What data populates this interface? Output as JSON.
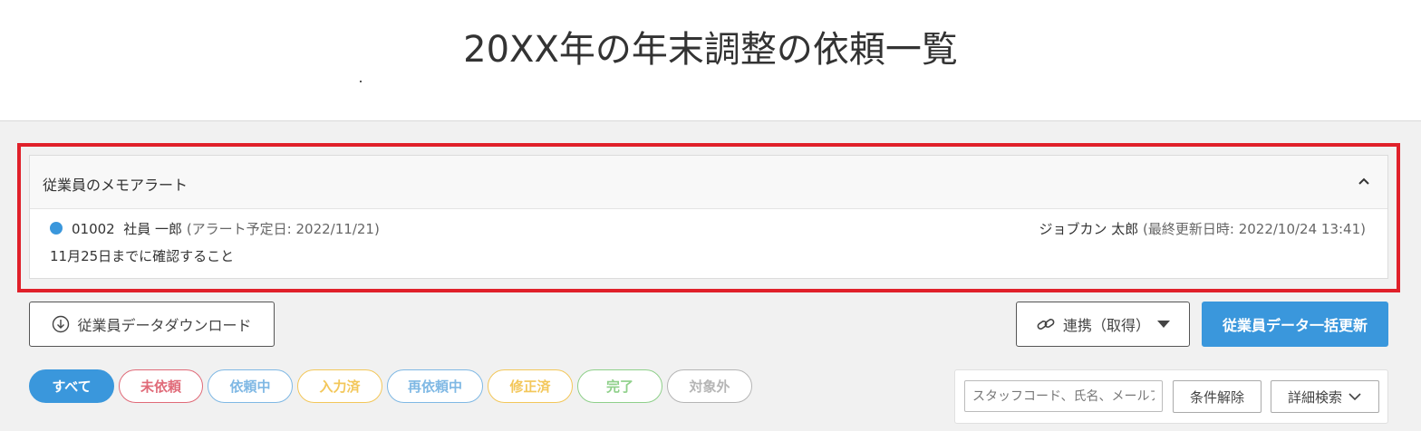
{
  "page": {
    "title": "20XX年の年末調整の依頼一覧"
  },
  "alert": {
    "section_title": "従業員のメモアラート",
    "entry": {
      "staff_code": "01002",
      "employee_name": "社員 一郎",
      "alert_date": "(アラート予定日: 2022/11/21)",
      "updated_by": "ジョブカン 太郎",
      "updated_at": "(最終更新日時: 2022/10/24 13:41)",
      "memo": "11月25日までに確認すること"
    }
  },
  "toolbar": {
    "download_label": "従業員データダウンロード",
    "sync_label": "連携（取得）",
    "bulk_update_label": "従業員データ一括更新"
  },
  "filters": [
    {
      "label": "すべて",
      "color": "#3a97dc",
      "active": true
    },
    {
      "label": "未依頼",
      "color": "#e06a78",
      "active": false
    },
    {
      "label": "依頼中",
      "color": "#7fb8e4",
      "active": false
    },
    {
      "label": "入力済",
      "color": "#f3c75a",
      "active": false
    },
    {
      "label": "再依頼中",
      "color": "#7fb8e4",
      "active": false
    },
    {
      "label": "修正済",
      "color": "#f3c75a",
      "active": false
    },
    {
      "label": "完了",
      "color": "#8fd08a",
      "active": false
    },
    {
      "label": "対象外",
      "color": "#b5b5b5",
      "active": false
    }
  ],
  "search": {
    "placeholder": "スタッフコード、氏名、メールアドレス",
    "clear_label": "条件解除",
    "detail_label": "詳細検索"
  }
}
